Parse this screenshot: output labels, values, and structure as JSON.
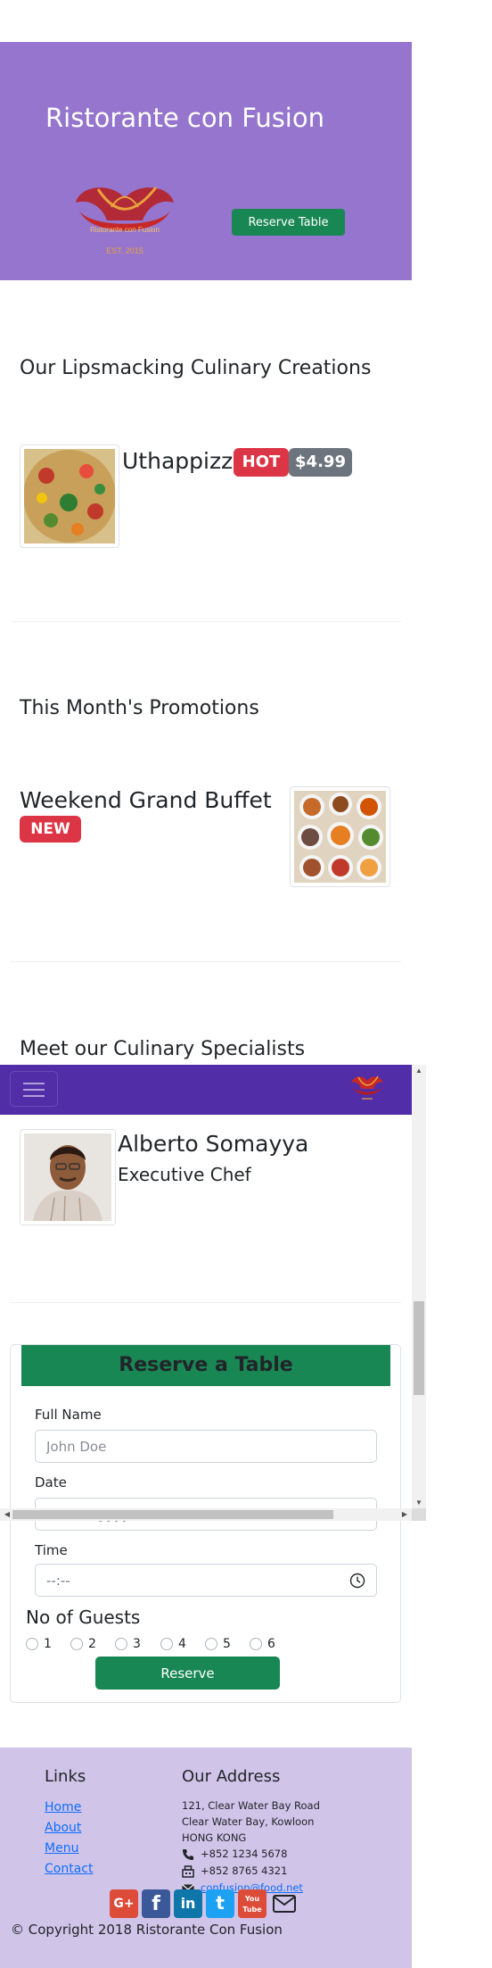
{
  "jumbotron": {
    "title": "Ristorante con Fusion",
    "logo_text_top": "Ristorante con Fusion",
    "logo_text_bottom": "EST. 2015",
    "reserve_button": "Reserve Table"
  },
  "dishes": {
    "heading": "Our Lipsmacking Culinary Creations",
    "item": {
      "name": "Uthappizza",
      "badge": "HOT",
      "price": "$4.99"
    }
  },
  "promotions": {
    "heading": "This Month's Promotions",
    "item": {
      "name": "Weekend Grand Buffet",
      "badge": "NEW"
    }
  },
  "leadership": {
    "heading": "Meet our Culinary Specialists",
    "item": {
      "name": "Alberto Somayya",
      "role": "Executive Chef"
    }
  },
  "navbar": {
    "toggle": "menu-icon",
    "logo": "logo-icon"
  },
  "reservation": {
    "title": "Reserve a Table",
    "fullname_label": "Full Name",
    "fullname_placeholder": "John Doe",
    "date_label": "Date",
    "date_placeholder": "dd/mm/yyyy",
    "time_label": "Time",
    "time_placeholder": "--:--",
    "guests_label": "No of Guests",
    "guest_options": [
      "1",
      "2",
      "3",
      "4",
      "5",
      "6"
    ],
    "submit": "Reserve"
  },
  "footer": {
    "links_heading": "Links",
    "links": [
      "Home",
      "About",
      "Menu",
      "Contact"
    ],
    "address_heading": "Our Address",
    "address": [
      "121, Clear Water Bay Road",
      "Clear Water Bay, Kowloon",
      "HONG KONG"
    ],
    "phone": "+852 1234 5678",
    "fax": "+852 8765 4321",
    "email": "confusion@food.net",
    "social": [
      "G+",
      "f",
      "in",
      "t",
      "You Tube"
    ],
    "copyright": "© Copyright 2018 Ristorante Con Fusion"
  },
  "colors": {
    "jumbotron": "#9575cd",
    "navbar": "#512da8",
    "footer": "#d1c4e9",
    "success": "#198754",
    "danger": "#dc3545",
    "secondary": "#6c757d"
  }
}
